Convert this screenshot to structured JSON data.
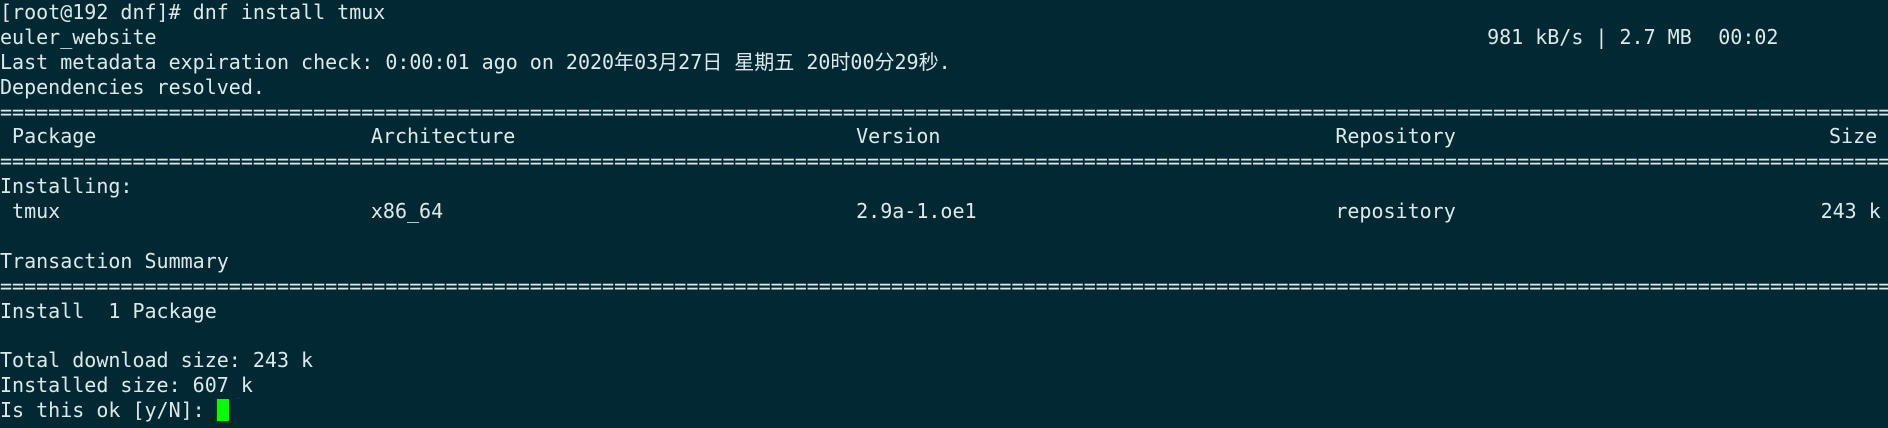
{
  "prompt": "[root@192 dnf]# dnf install tmux",
  "repo_sync": {
    "name": "euler_website",
    "speed": "981 kB/s",
    "divider": "|",
    "size": "2.7 MB",
    "time": "00:02"
  },
  "metadata_line": "Last metadata expiration check: 0:00:01 ago on 2020年03月27日 星期五 20时00分29秒.",
  "deps_line": "Dependencies resolved.",
  "separator": "=============================================================================================================================================================",
  "table": {
    "headers": [
      "Package",
      "Architecture",
      "Version",
      "Repository",
      "Size"
    ],
    "section": "Installing:",
    "rows": [
      {
        "package": "tmux",
        "arch": "x86_64",
        "version": "2.9a-1.oe1",
        "repo": "repository",
        "size": "243 k"
      }
    ]
  },
  "summary": {
    "title": "Transaction Summary",
    "install": "Install  1 Package",
    "total_download": "Total download size: 243 k",
    "installed_size": "Installed size: 607 k",
    "question": "Is this ok [y/N]: "
  },
  "cursor_color": "#00ff00"
}
